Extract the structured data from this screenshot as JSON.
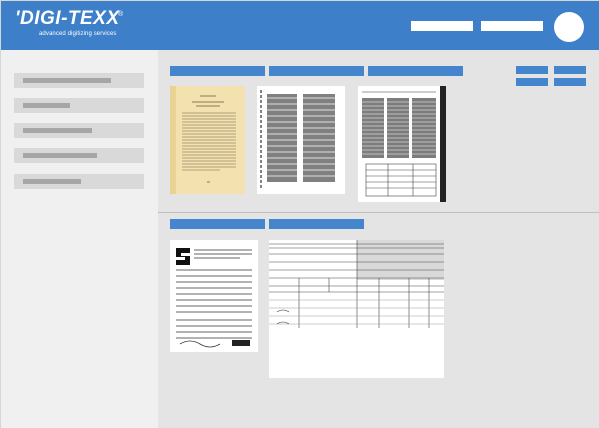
{
  "header": {
    "logo_main": "'DIGI-TEXX",
    "logo_reg": "®",
    "logo_tagline": "advanced digitizing services",
    "brand_color": "#3d7fc9"
  },
  "sidebar": {
    "items": [
      {
        "id": "item-1"
      },
      {
        "id": "item-2"
      },
      {
        "id": "item-3"
      },
      {
        "id": "item-4"
      },
      {
        "id": "item-5"
      }
    ]
  },
  "icons": {
    "avatar": "user-avatar-icon"
  },
  "colors": {
    "tab_blue": "#4585cd",
    "placeholder_grey": "#a6a6a6",
    "background": "#e4e4e4",
    "sidebar_bg": "#f0f0f0"
  }
}
